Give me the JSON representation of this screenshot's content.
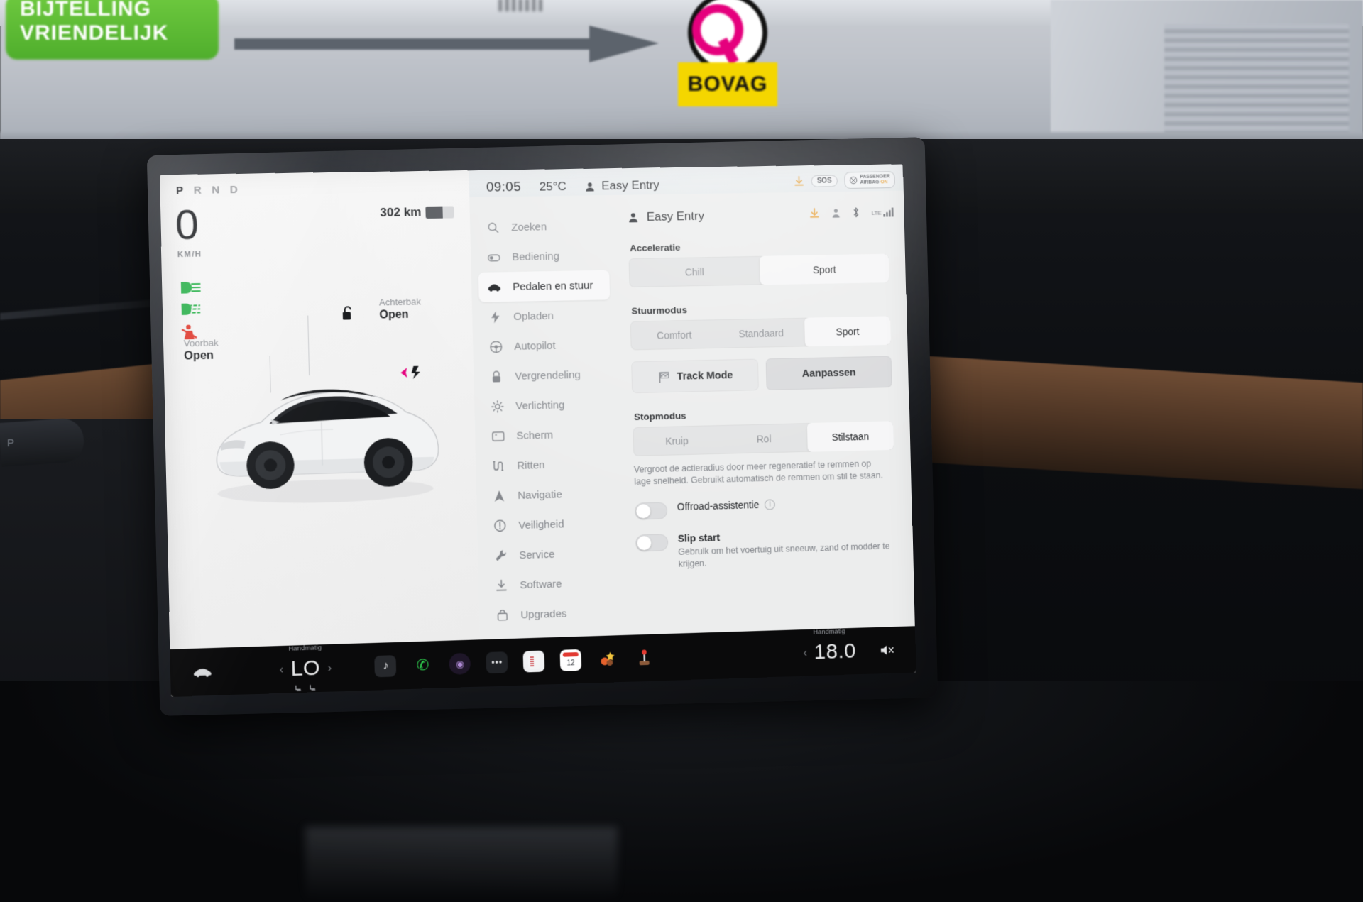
{
  "photo": {
    "backdrop_sign_text": "BIJTELLING\nVRIENDELIJK",
    "bovag_label": "BOVAG",
    "stalk_label": "P"
  },
  "drive_pane": {
    "gear_indicator": "P R N D",
    "gear_selected": "P",
    "speed": "0",
    "speed_unit": "KM/H",
    "range": "302 km",
    "battery_percent": 60,
    "frunk": {
      "label": "Voorbak",
      "value": "Open"
    },
    "trunk": {
      "label": "Achterbak",
      "value": "Open"
    },
    "telltales": [
      "headlight-icon",
      "fog-light-icon",
      "seatbelt-warning-icon"
    ]
  },
  "statusbar": {
    "time": "09:05",
    "temperature": "25°C",
    "profile": "Easy Entry",
    "sos_label": "SOS",
    "airbag_line1": "PASSENGER",
    "airbag_line2": "AIRBAG",
    "airbag_state": "ON"
  },
  "sidebar": {
    "search_placeholder": "Zoeken",
    "items": [
      {
        "label": "Zoeken",
        "icon": "search-icon",
        "active": false
      },
      {
        "label": "Bediening",
        "icon": "toggle-icon",
        "active": false
      },
      {
        "label": "Pedalen en stuur",
        "icon": "car-icon",
        "active": true
      },
      {
        "label": "Opladen",
        "icon": "bolt-icon",
        "active": false
      },
      {
        "label": "Autopilot",
        "icon": "steering-wheel-icon",
        "active": false
      },
      {
        "label": "Vergrendeling",
        "icon": "lock-icon",
        "active": false
      },
      {
        "label": "Verlichting",
        "icon": "sun-icon",
        "active": false
      },
      {
        "label": "Scherm",
        "icon": "display-icon",
        "active": false
      },
      {
        "label": "Ritten",
        "icon": "trips-icon",
        "active": false
      },
      {
        "label": "Navigatie",
        "icon": "navigation-arrow-icon",
        "active": false
      },
      {
        "label": "Veiligheid",
        "icon": "warning-circle-icon",
        "active": false
      },
      {
        "label": "Service",
        "icon": "wrench-icon",
        "active": false
      },
      {
        "label": "Software",
        "icon": "download-icon",
        "active": false
      },
      {
        "label": "Upgrades",
        "icon": "bag-icon",
        "active": false
      }
    ]
  },
  "panel": {
    "profile_title": "Easy Entry",
    "header_icons": [
      "download-icon",
      "user-icon",
      "bluetooth-icon",
      "lte-signal-icon"
    ],
    "lte_label": "LTE",
    "acceleration": {
      "title": "Acceleratie",
      "options": [
        "Chill",
        "Sport"
      ],
      "selected": "Sport"
    },
    "steering_mode": {
      "title": "Stuurmodus",
      "options": [
        "Comfort",
        "Standaard",
        "Sport"
      ],
      "selected": "Sport"
    },
    "track_mode_button": "Track Mode",
    "customize_button": "Aanpassen",
    "stop_mode": {
      "title": "Stopmodus",
      "options": [
        "Kruip",
        "Rol",
        "Stilstaan"
      ],
      "selected": "Stilstaan",
      "description": "Vergroot de actieradius door meer regeneratief te remmen op lage snelheid. Gebruikt automatisch de remmen om stil te staan."
    },
    "offroad": {
      "label": "Offroad-assistentie",
      "enabled": false,
      "info": "i"
    },
    "slip_start": {
      "label": "Slip start",
      "enabled": false,
      "description": "Gebruik om het voertuig uit sneeuw, zand of modder te krijgen."
    }
  },
  "dock": {
    "car_icon": "car-icon",
    "left_climate": {
      "mode": "Handmatig",
      "value": "LO",
      "prev": "‹",
      "next": "›"
    },
    "apps": [
      {
        "name": "media-app-icon",
        "glyph": "♪"
      },
      {
        "name": "phone-app-icon",
        "glyph": "✆"
      },
      {
        "name": "camera-app-icon",
        "glyph": "◉"
      },
      {
        "name": "more-apps-icon",
        "glyph": "•••"
      },
      {
        "name": "toybox-app-icon",
        "glyph": ""
      },
      {
        "name": "calendar-app-icon",
        "glyph": "12"
      },
      {
        "name": "theater-app-icon",
        "glyph": ""
      },
      {
        "name": "joystick-app-icon",
        "glyph": ""
      }
    ],
    "right_climate": {
      "mode": "Handmatig",
      "value": "18.0",
      "prev": "‹"
    },
    "mute_icon": "volume-mute-icon"
  },
  "colors": {
    "accent_orange": "#e8a33d",
    "screen_bg": "#f2f2f2",
    "panel_bg": "#eceded",
    "active_pill": "#f7f7f8",
    "text_primary": "#1f2124",
    "text_muted": "#84878c",
    "dock_bg": "#0a0a0b",
    "telltale_green": "#2bb24c",
    "telltale_red": "#e03a2f"
  }
}
